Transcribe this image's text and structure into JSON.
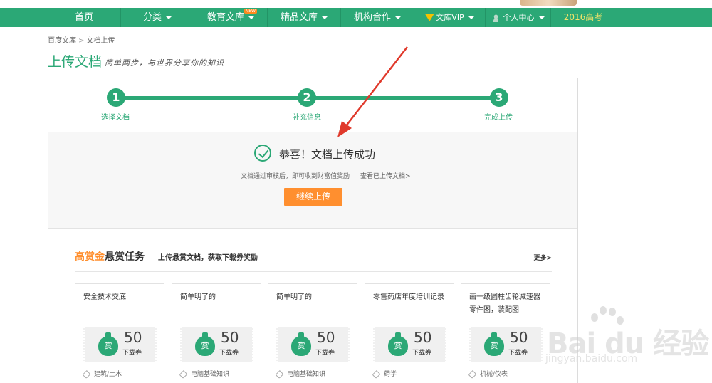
{
  "nav": {
    "items": [
      {
        "label": "首页",
        "caret": false
      },
      {
        "label": "分类",
        "caret": true
      },
      {
        "label": "教育文库",
        "caret": true,
        "badge": "NEW"
      },
      {
        "label": "精品文库",
        "caret": true
      },
      {
        "label": "机构合作",
        "caret": true
      },
      {
        "label": "文库VIP",
        "caret": true
      },
      {
        "label": "个人中心",
        "caret": true
      },
      {
        "label": "2016高考",
        "caret": false
      }
    ],
    "colors": {
      "bg": "#2ba876",
      "highlight": "#f3e26a"
    }
  },
  "breadcrumb": {
    "root": "百度文库",
    "sep": ">",
    "current": "文档上传"
  },
  "page": {
    "title": "上传文档",
    "subtitle": "简单两步，与世界分享你的知识"
  },
  "steps": [
    {
      "num": "1",
      "label": "选择文档"
    },
    {
      "num": "2",
      "label": "补充信息"
    },
    {
      "num": "3",
      "label": "完成上传"
    }
  ],
  "success": {
    "title": "恭喜！文档上传成功",
    "note": "文档通过审核后，即可收到财富值奖励",
    "link": "查看已上传文档>",
    "button": "继续上传"
  },
  "reward": {
    "title_highlight": "高赏金",
    "title_rest": "悬赏任务",
    "subtitle": "上传悬赏文档，获取下载券奖励",
    "more": "更多>",
    "cards": [
      {
        "title": "安全技术交底",
        "amount": "50",
        "unit": "下载券",
        "bag_label": "赏",
        "tag": "建筑/土木"
      },
      {
        "title": "简单明了的",
        "amount": "50",
        "unit": "下载券",
        "bag_label": "赏",
        "tag": "电脑基础知识"
      },
      {
        "title": "简单明了的",
        "amount": "50",
        "unit": "下载券",
        "bag_label": "赏",
        "tag": "电脑基础知识"
      },
      {
        "title": "零售药店年度培训记录",
        "amount": "50",
        "unit": "下载券",
        "bag_label": "赏",
        "tag": "药学"
      },
      {
        "title": "画一级圆柱齿轮减速器零件图，装配图",
        "amount": "50",
        "unit": "下载券",
        "bag_label": "赏",
        "tag": "机械/仪表"
      }
    ]
  },
  "watermark": {
    "brand": "Bai du 经验",
    "url": "jingyan.baidu.com"
  },
  "colors": {
    "accent": "#2ba876",
    "orange": "#ff8f2f",
    "arrow": "#e0392b"
  }
}
